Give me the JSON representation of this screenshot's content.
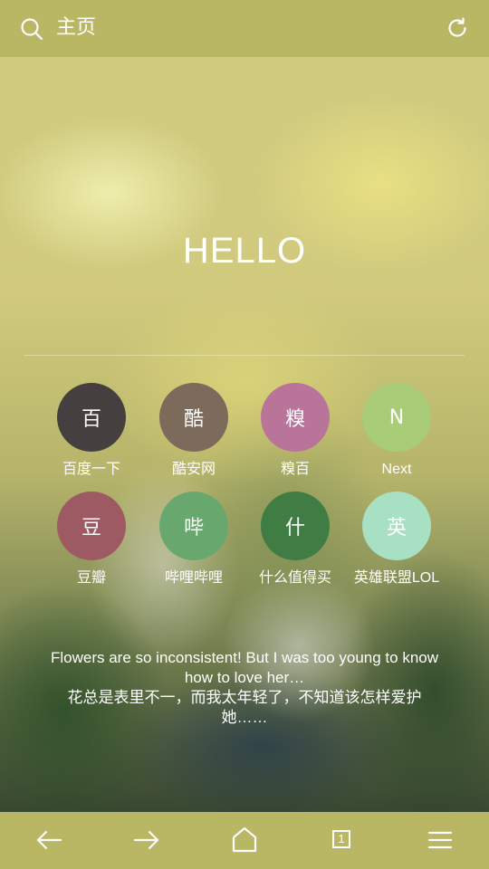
{
  "header": {
    "title": "主页",
    "left_icon": "search-icon",
    "right_icon": "refresh-icon"
  },
  "main": {
    "heading": "HELLO",
    "shortcuts": [
      {
        "glyph": "百",
        "label": "百度一下",
        "color": "#45403f"
      },
      {
        "glyph": "酷",
        "label": "酷安网",
        "color": "#7c6a5a"
      },
      {
        "glyph": "糗",
        "label": "糗百",
        "color": "#b9749a"
      },
      {
        "glyph": "N",
        "label": "Next",
        "color": "#a8cc78"
      },
      {
        "glyph": "豆",
        "label": "豆瓣",
        "color": "#9e5a62"
      },
      {
        "glyph": "哔",
        "label": "哔哩哔哩",
        "color": "#68a86e"
      },
      {
        "glyph": "什",
        "label": "什么值得买",
        "color": "#3f7d44"
      },
      {
        "glyph": "英",
        "label": "英雄联盟LOL",
        "color": "#a8e0c4"
      }
    ],
    "quote_en": "Flowers are so inconsistent! But I was too young to know how to love her…",
    "quote_zh": "花总是表里不一，而我太年轻了，不知道该怎样爱护她……"
  },
  "bottom_nav": {
    "items": [
      "back-icon",
      "forward-icon",
      "home-icon",
      "tabs-icon",
      "menu-icon"
    ],
    "tab_count": "1"
  },
  "colors": {
    "bar": "#b9b664",
    "text": "#ffffff"
  }
}
